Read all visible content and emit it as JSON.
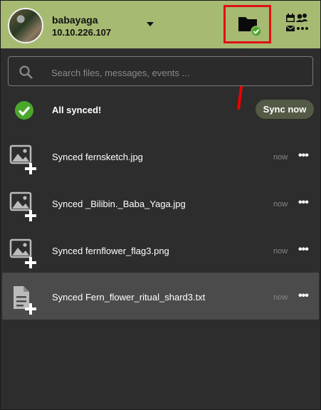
{
  "account": {
    "name": "babayaga",
    "server": "10.10.226.107"
  },
  "search": {
    "placeholder": "Search files, messages, events ..."
  },
  "status": {
    "label": "All synced!",
    "sync_button": "Sync now"
  },
  "activities": [
    {
      "text": "Synced fernsketch.jpg",
      "time": "now",
      "icon": "image-add-icon"
    },
    {
      "text": "Synced _Bilibin._Baba_Yaga.jpg",
      "time": "now",
      "icon": "image-add-icon"
    },
    {
      "text": "Synced fernflower_flag3.png",
      "time": "now",
      "icon": "image-add-icon"
    },
    {
      "text": "Synced Fern_flower_ritual_shard3.txt",
      "time": "now",
      "icon": "document-add-icon"
    }
  ],
  "colors": {
    "header": "#a7ba72",
    "background": "#2d2d2d",
    "success": "#49a72c",
    "highlight_box": "#e01010"
  }
}
